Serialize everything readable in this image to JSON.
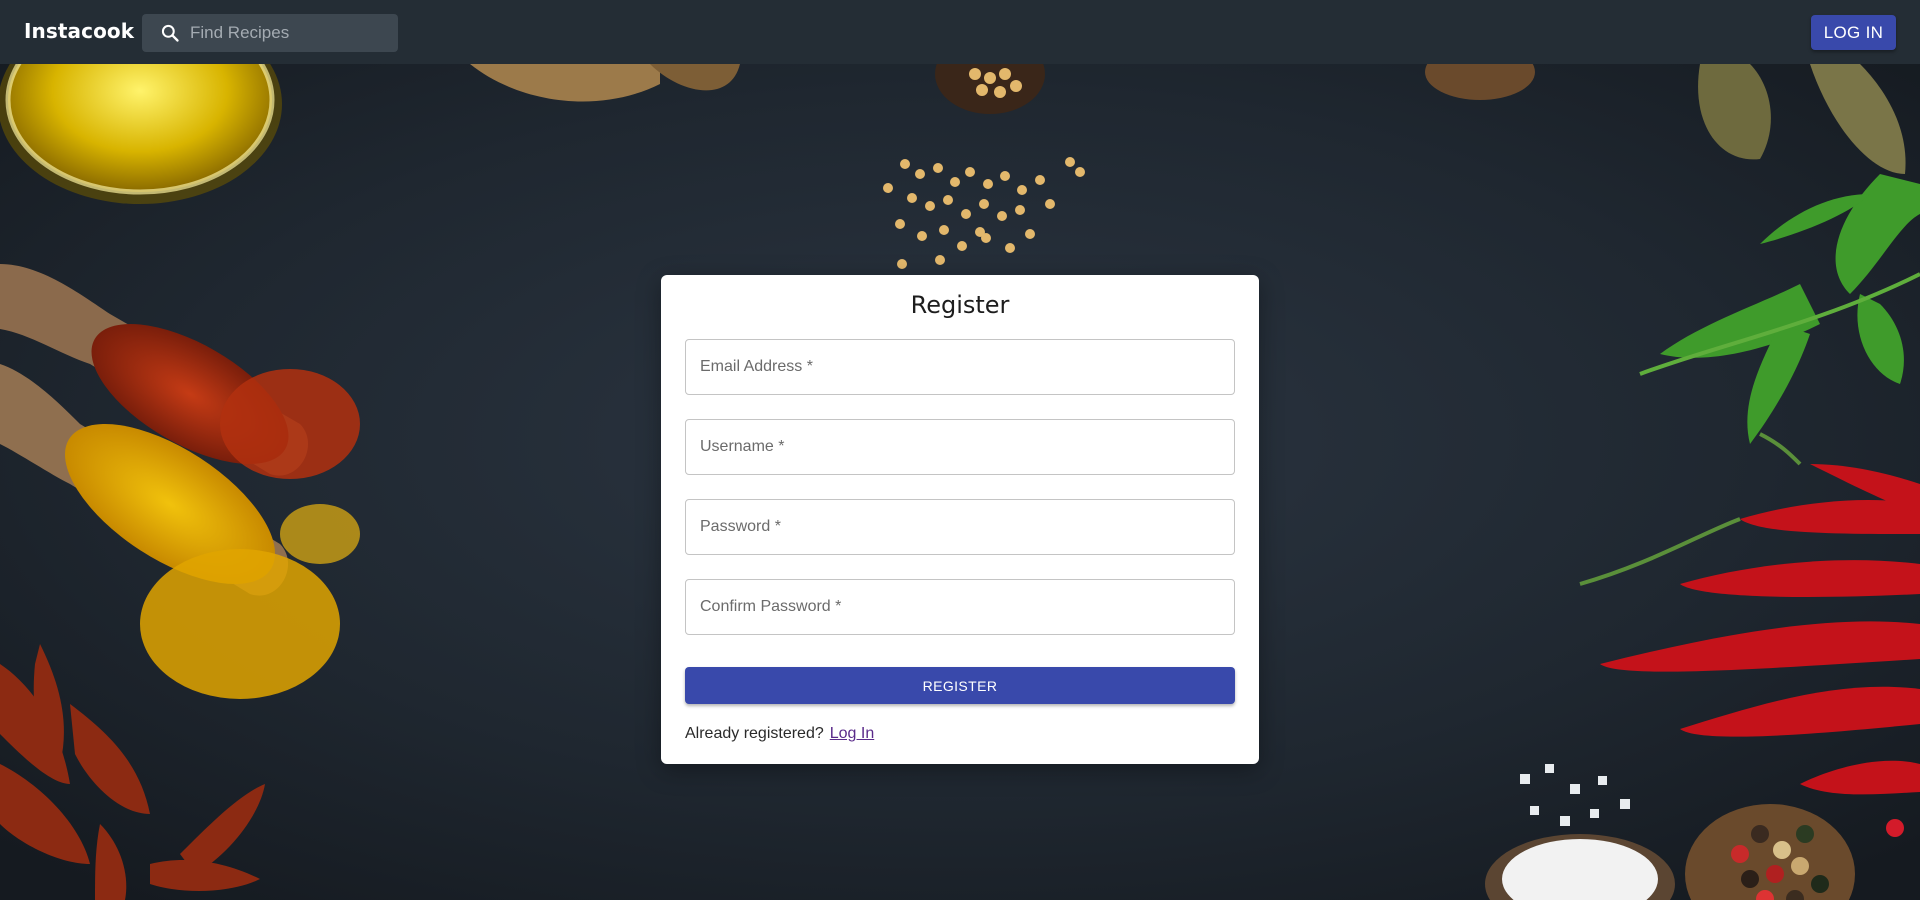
{
  "header": {
    "brand": "Instacook",
    "search_placeholder": "Find Recipes",
    "search_icon": "search-icon",
    "login_label": "LOG IN"
  },
  "register": {
    "title": "Register",
    "fields": [
      {
        "label": "Email Address *",
        "value": ""
      },
      {
        "label": "Username *",
        "value": ""
      },
      {
        "label": "Password *",
        "value": ""
      },
      {
        "label": "Confirm Password *",
        "value": ""
      }
    ],
    "submit_label": "REGISTER",
    "already_text": "Already registered?",
    "login_link": "Log In"
  },
  "colors": {
    "topbar": "#242d35",
    "accent": "#3949ab",
    "background": "#1b2127"
  }
}
